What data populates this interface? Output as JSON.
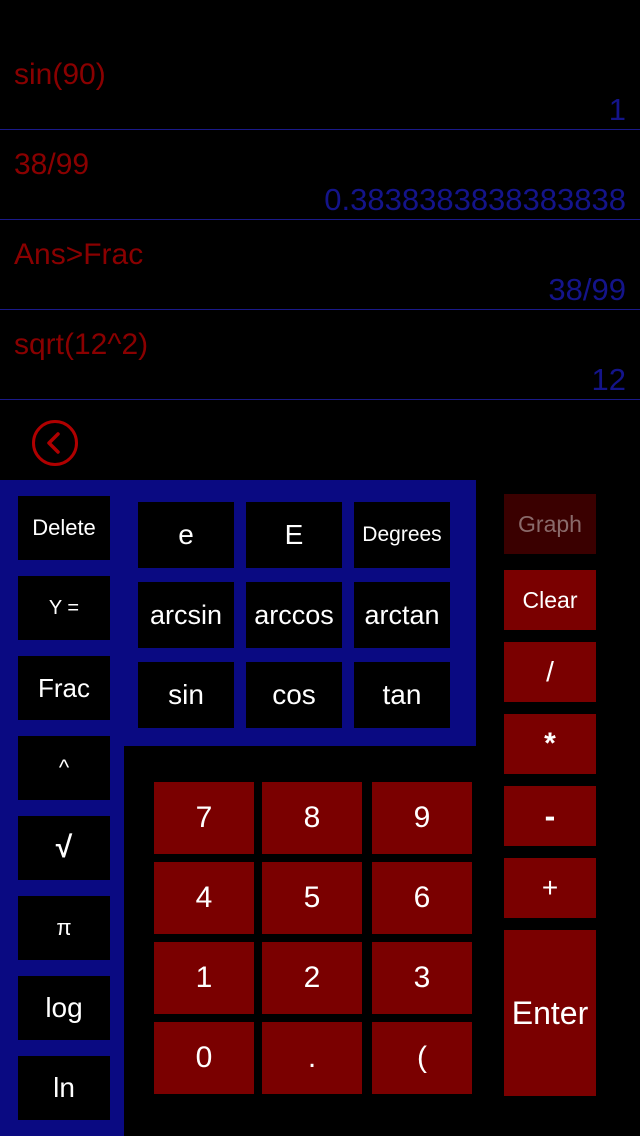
{
  "history": [
    {
      "expression": "sin(90)",
      "result": "1"
    },
    {
      "expression": "38/99",
      "result": "0.3838383838383838"
    },
    {
      "expression": "Ans>Frac",
      "result": "38/99"
    },
    {
      "expression": "sqrt(12^2)",
      "result": "12"
    }
  ],
  "left_keys": {
    "delete": "Delete",
    "y_equals": "Y =",
    "frac": "Frac",
    "power": "^",
    "sqrt": "√",
    "pi": "π",
    "log": "log",
    "ln": "ln"
  },
  "function_keys": {
    "e": "e",
    "E": "E",
    "degrees": "Degrees",
    "arcsin": "arcsin",
    "arccos": "arccos",
    "arctan": "arctan",
    "sin": "sin",
    "cos": "cos",
    "tan": "tan"
  },
  "number_keys": {
    "seven": "7",
    "eight": "8",
    "nine": "9",
    "four": "4",
    "five": "5",
    "six": "6",
    "one": "1",
    "two": "2",
    "three": "3",
    "zero": "0",
    "dot": ".",
    "paren": "("
  },
  "right_keys": {
    "graph": "Graph",
    "clear": "Clear",
    "divide": "/",
    "multiply": "*",
    "minus": "-",
    "plus": "+",
    "enter": "Enter"
  },
  "icons": {
    "back": "chevron-left-circle-icon"
  },
  "colors": {
    "background": "#000000",
    "expression_text": "#8a0000",
    "result_text": "#14148a",
    "panel_blue": "#0a0a82",
    "key_red": "#7a0000",
    "graph_disabled": "#3a0000"
  }
}
